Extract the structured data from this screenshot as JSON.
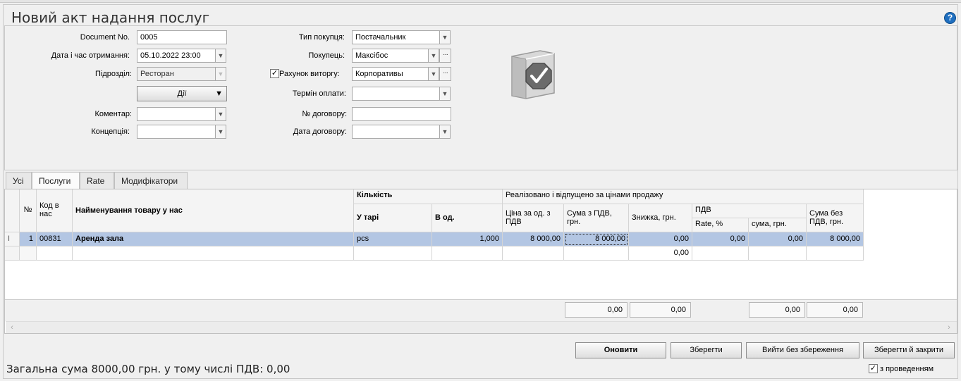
{
  "window": {
    "title": "Новий акт надання послуг",
    "help_label": "?"
  },
  "form": {
    "doc_no_label": "Document No.",
    "doc_no_value": "0005",
    "received_label": "Дата і час отримання:",
    "received_value": "05.10.2022 23:00",
    "division_label": "Підрозділ:",
    "division_value": "Ресторан",
    "actions_label": "Дії",
    "comment_label": "Коментар:",
    "comment_value": "",
    "concept_label": "Концепція:",
    "concept_value": "",
    "purchase_type_label": "Тип покупця:",
    "purchase_type_value": "Постачальник",
    "buyer_label": "Покупець:",
    "buyer_value": "Максібос",
    "revenue_account_label": "Рахунок виторгу:",
    "revenue_account_checked": true,
    "revenue_account_value": "Корпоративы",
    "payment_term_label": "Термін оплати:",
    "payment_term_value": "",
    "contract_no_label": "№ договору:",
    "contract_no_value": "",
    "contract_date_label": "Дата договору:",
    "contract_date_value": ""
  },
  "tabs": [
    "Усі",
    "Послуги",
    "Rate",
    "Модифікатори"
  ],
  "active_tab": "Послуги",
  "grid": {
    "headers": {
      "no": "№",
      "code": "Код в нас",
      "name": "Найменування товару у нас",
      "quantity": "Кількість",
      "in_pack": "У тарі",
      "in_units": "В од.",
      "sold_group": "Реалізовано і відпущено за цінами продажу",
      "unit_price": "Ціна за од. з ПДВ",
      "sum_vat": "Сума з ПДВ, грн.",
      "discount": "Знижка, грн.",
      "vat_group": "ПДВ",
      "vat_rate": "Rate, %",
      "vat_sum": "сума, грн.",
      "sum_no_vat": "Сума без ПДВ, грн."
    },
    "rows": [
      {
        "marker": "I",
        "no": "1",
        "code": "00831",
        "name": "Аренда зала",
        "in_pack": "pcs",
        "in_units": "1,000",
        "unit_price": "8 000,00",
        "sum_vat": "8 000,00",
        "discount": "0,00",
        "vat_rate": "0,00",
        "vat_sum": "0,00",
        "sum_no_vat": "8 000,00"
      },
      {
        "marker": "",
        "no": "",
        "code": "",
        "name": "",
        "in_pack": "",
        "in_units": "",
        "unit_price": "",
        "sum_vat": "",
        "discount": "0,00",
        "vat_rate": "",
        "vat_sum": "",
        "sum_no_vat": ""
      }
    ],
    "totals": {
      "sum_vat": "0,00",
      "discount": "0,00",
      "vat_sum": "0,00",
      "sum_no_vat": "0,00"
    }
  },
  "footer": {
    "total_text": "Загальна сума 8000,00 грн. у тому числі ПДВ: 0,00",
    "update_label": "Оновити",
    "save_label": "Зберегти",
    "exit_label": "Вийти без збереження",
    "save_close_label": "Зберегти й закрити",
    "posted_label": "з проведенням",
    "posted_checked": true
  },
  "colors": {
    "selected_row": "#b3c6e3",
    "help_icon": "#1f6fc0"
  }
}
